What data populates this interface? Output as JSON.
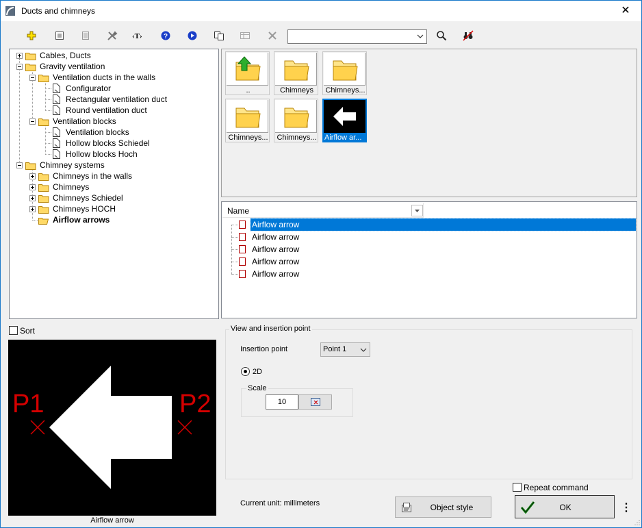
{
  "window": {
    "title": "Ducts and chimneys",
    "close_glyph": "✕"
  },
  "toolbar": {
    "buttons": [
      "add-icon",
      "properties-icon",
      "list-icon",
      "tools-icon",
      "text-icon",
      "help-icon",
      "play-icon",
      "copy-icon",
      "table-icon",
      "delete-icon"
    ],
    "search_value": "",
    "search_icon": "magnifier-icon",
    "find_icon": "binoculars-icon"
  },
  "tree": {
    "items": [
      {
        "label": "Cables, Ducts",
        "bold": false
      },
      {
        "label": "Gravity ventilation",
        "bold": false
      },
      {
        "label": "Ventilation ducts in the walls",
        "bold": false
      },
      {
        "label": "Configurator",
        "bold": false
      },
      {
        "label": "Rectangular ventilation duct",
        "bold": false
      },
      {
        "label": "Round ventilation duct",
        "bold": false
      },
      {
        "label": "Ventilation blocks",
        "bold": false
      },
      {
        "label": "Ventilation blocks",
        "bold": false
      },
      {
        "label": "Hollow blocks Schiedel",
        "bold": false
      },
      {
        "label": "Hollow blocks Hoch",
        "bold": false
      },
      {
        "label": "Chimney systems",
        "bold": false
      },
      {
        "label": "Chimneys in the walls",
        "bold": false
      },
      {
        "label": "Chimneys",
        "bold": false
      },
      {
        "label": "Chimneys Schiedel",
        "bold": false
      },
      {
        "label": "Chimneys HOCH",
        "bold": false
      },
      {
        "label": "Airflow arrows",
        "bold": true
      }
    ]
  },
  "thumbnails": [
    {
      "caption": "..",
      "kind": "up-folder"
    },
    {
      "caption": "Chimneys",
      "kind": "folder"
    },
    {
      "caption": "Chimneys...",
      "kind": "folder"
    },
    {
      "caption": "Chimneys...",
      "kind": "folder"
    },
    {
      "caption": "Chimneys...",
      "kind": "folder"
    },
    {
      "caption": "Airflow ar...",
      "kind": "arrow",
      "selected": true
    }
  ],
  "list": {
    "column_header": "Name",
    "rows": [
      {
        "label": "Airflow arrow",
        "selected": true
      },
      {
        "label": "Airflow arrow",
        "selected": false
      },
      {
        "label": "Airflow arrow",
        "selected": false
      },
      {
        "label": "Airflow arrow",
        "selected": false
      },
      {
        "label": "Airflow arrow",
        "selected": false
      }
    ]
  },
  "sort": {
    "label": "Sort",
    "checked": false
  },
  "preview": {
    "caption": "Airflow arrow",
    "p1": "P1",
    "p2": "P2",
    "cross": "×"
  },
  "view_group": {
    "legend": "View and insertion point",
    "insertion_label": "Insertion point",
    "insertion_value": "Point 1",
    "view_option": "2D",
    "scale_legend": "Scale",
    "scale_value": "10"
  },
  "footer": {
    "current_unit": "Current unit: millimeters",
    "object_style": "Object style",
    "repeat_command": "Repeat command",
    "repeat_checked": false,
    "ok": "OK",
    "more": "⋮"
  },
  "colors": {
    "accent": "#0078d7",
    "preview_bg": "#000000",
    "marker_red": "#d40000"
  }
}
